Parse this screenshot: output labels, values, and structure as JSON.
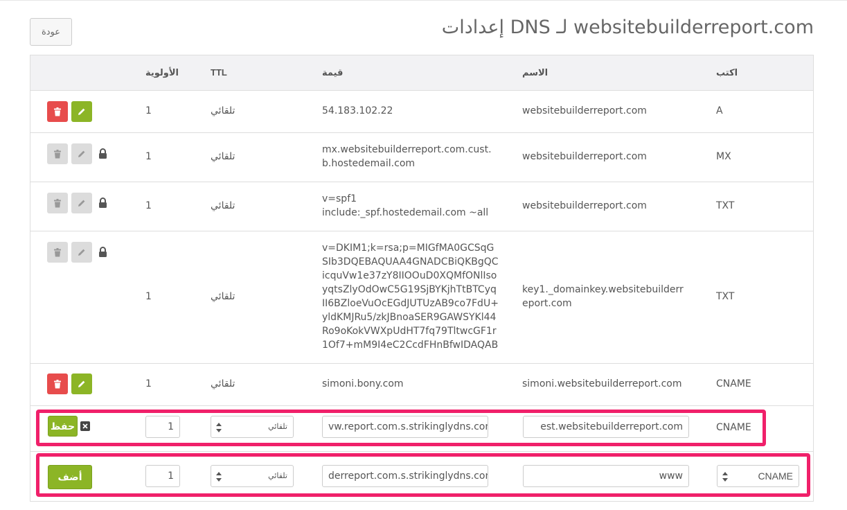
{
  "page": {
    "title": "إعدادات DNS لـ websitebuilderreport.com",
    "back_label": "عودة"
  },
  "table": {
    "headers": {
      "type": "اكتب",
      "name": "الاسم",
      "value": "قيمة",
      "ttl": "TTL",
      "priority": "الأولوية"
    },
    "rows": [
      {
        "type": "A",
        "name": "websitebuilderreport.com",
        "value": "54.183.102.22",
        "ttl": "تلقائي",
        "priority": "1",
        "locked": false
      },
      {
        "type": "MX",
        "name": "websitebuilderreport.com",
        "value": "mx.websitebuilderreport.com.cust.b.hostedemail.com",
        "ttl": "تلقائي",
        "priority": "1",
        "locked": true
      },
      {
        "type": "TXT",
        "name": "websitebuilderreport.com",
        "value": "v=spf1 include:_spf.hostedemail.com ~all",
        "ttl": "تلقائي",
        "priority": "1",
        "locked": true
      },
      {
        "type": "TXT",
        "name": "key1._domainkey.websitebuilderreport.com",
        "value": "v=DKIM1;k=rsa;p=MIGfMA0GCSqGSIb3DQEBAQUAA4GNADCBiQKBgQCicquVw1e37zY8IIOOuD0XQMfONlIsoyqtsZlyOdOwC5G19SjBYKjhTtBTCyqII6BZloeVuOcEGdJUTUzAB9co7FdU+yldKMJRu5/zkJBnoaSER9GAWSYKl44Ro9oKokVWXpUdHT7fq79TltwcGF1r1Of7+mM9I4eC2CcdFHnBfwIDAQAB",
        "ttl": "تلقائي",
        "priority": "1",
        "locked": true
      },
      {
        "type": "CNAME",
        "name": "simoni.websitebuilderreport.com",
        "value": "simoni.bony.com",
        "ttl": "تلقائي",
        "priority": "1",
        "locked": false
      }
    ]
  },
  "edit_row": {
    "type": "CNAME",
    "name_value": "est.websitebuilderreport.com",
    "value_value": "vw.report.com.s.strikinglydns.com",
    "ttl_selected": "تلقائي",
    "priority_value": "1",
    "save_label": "حفظ"
  },
  "add_row": {
    "type_selected": "CNAME",
    "name_value": "www",
    "value_value": "derreport.com.s.strikinglydns.com",
    "ttl_selected": "تلقائي",
    "priority_value": "1",
    "add_label": "أضف"
  },
  "colors": {
    "highlight": "#f0206a",
    "green": "#8cb526",
    "red": "#e74c4c"
  }
}
